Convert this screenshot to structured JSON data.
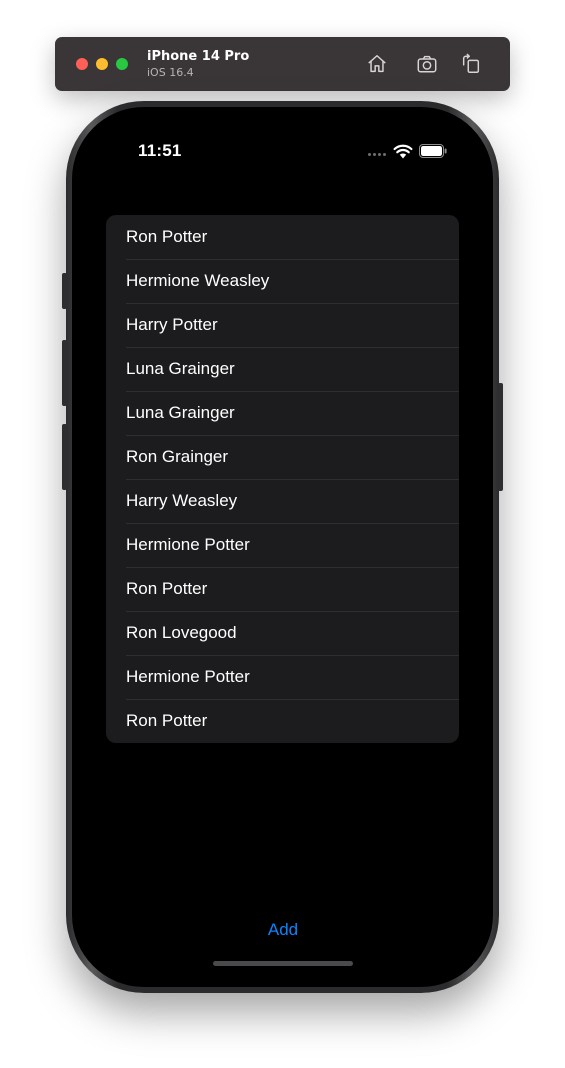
{
  "simulator": {
    "device": "iPhone 14 Pro",
    "os": "iOS 16.4",
    "controls": [
      "home-icon",
      "screenshot-icon",
      "rotate-icon"
    ]
  },
  "status_bar": {
    "time": "11:51"
  },
  "list": {
    "items": [
      "Ron Potter",
      "Hermione Weasley",
      "Harry Potter",
      "Luna Grainger",
      "Luna Grainger",
      "Ron Grainger",
      "Harry Weasley",
      "Hermione Potter",
      "Ron Potter",
      "Ron Lovegood",
      "Hermione Potter",
      "Ron Potter"
    ]
  },
  "toolbar": {
    "add_label": "Add"
  },
  "colors": {
    "accent": "#0a84ff",
    "list_background": "#1c1c1e",
    "screen_background": "#000000"
  }
}
